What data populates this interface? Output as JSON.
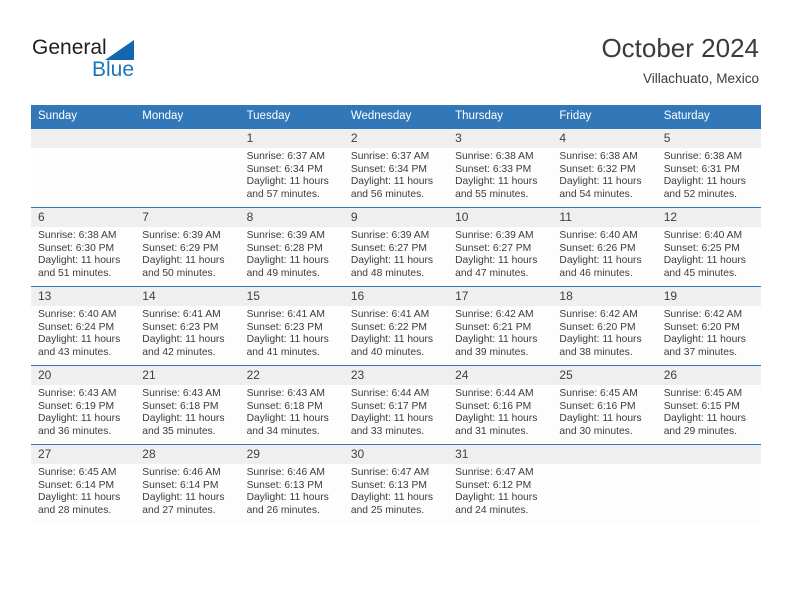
{
  "brand": {
    "name_part1": "General",
    "name_part2": "Blue",
    "triangle_icon": "triangle-icon",
    "accent_color": "#1b75bb"
  },
  "header": {
    "title": "October 2024",
    "subtitle": "Villachuato, Mexico"
  },
  "theme": {
    "header_row_bg": "#3277b8",
    "date_band_bg": "#efefef",
    "cell_bg": "#fdfdfd",
    "border_color": "#3277b8",
    "text_color": "#3c3c3c"
  },
  "labels": {
    "sunrise_prefix": "Sunrise:",
    "sunset_prefix": "Sunset:",
    "daylight_prefix": "Daylight:"
  },
  "day_headers": [
    "Sunday",
    "Monday",
    "Tuesday",
    "Wednesday",
    "Thursday",
    "Friday",
    "Saturday"
  ],
  "weeks": [
    [
      {
        "date": "",
        "empty": true
      },
      {
        "date": "",
        "empty": true
      },
      {
        "date": "1",
        "sunrise": "Sunrise: 6:37 AM",
        "sunset": "Sunset: 6:34 PM",
        "daylight_l1": "Daylight: 11 hours",
        "daylight_l2": "and 57 minutes."
      },
      {
        "date": "2",
        "sunrise": "Sunrise: 6:37 AM",
        "sunset": "Sunset: 6:34 PM",
        "daylight_l1": "Daylight: 11 hours",
        "daylight_l2": "and 56 minutes."
      },
      {
        "date": "3",
        "sunrise": "Sunrise: 6:38 AM",
        "sunset": "Sunset: 6:33 PM",
        "daylight_l1": "Daylight: 11 hours",
        "daylight_l2": "and 55 minutes."
      },
      {
        "date": "4",
        "sunrise": "Sunrise: 6:38 AM",
        "sunset": "Sunset: 6:32 PM",
        "daylight_l1": "Daylight: 11 hours",
        "daylight_l2": "and 54 minutes."
      },
      {
        "date": "5",
        "sunrise": "Sunrise: 6:38 AM",
        "sunset": "Sunset: 6:31 PM",
        "daylight_l1": "Daylight: 11 hours",
        "daylight_l2": "and 52 minutes."
      }
    ],
    [
      {
        "date": "6",
        "sunrise": "Sunrise: 6:38 AM",
        "sunset": "Sunset: 6:30 PM",
        "daylight_l1": "Daylight: 11 hours",
        "daylight_l2": "and 51 minutes."
      },
      {
        "date": "7",
        "sunrise": "Sunrise: 6:39 AM",
        "sunset": "Sunset: 6:29 PM",
        "daylight_l1": "Daylight: 11 hours",
        "daylight_l2": "and 50 minutes."
      },
      {
        "date": "8",
        "sunrise": "Sunrise: 6:39 AM",
        "sunset": "Sunset: 6:28 PM",
        "daylight_l1": "Daylight: 11 hours",
        "daylight_l2": "and 49 minutes."
      },
      {
        "date": "9",
        "sunrise": "Sunrise: 6:39 AM",
        "sunset": "Sunset: 6:27 PM",
        "daylight_l1": "Daylight: 11 hours",
        "daylight_l2": "and 48 minutes."
      },
      {
        "date": "10",
        "sunrise": "Sunrise: 6:39 AM",
        "sunset": "Sunset: 6:27 PM",
        "daylight_l1": "Daylight: 11 hours",
        "daylight_l2": "and 47 minutes."
      },
      {
        "date": "11",
        "sunrise": "Sunrise: 6:40 AM",
        "sunset": "Sunset: 6:26 PM",
        "daylight_l1": "Daylight: 11 hours",
        "daylight_l2": "and 46 minutes."
      },
      {
        "date": "12",
        "sunrise": "Sunrise: 6:40 AM",
        "sunset": "Sunset: 6:25 PM",
        "daylight_l1": "Daylight: 11 hours",
        "daylight_l2": "and 45 minutes."
      }
    ],
    [
      {
        "date": "13",
        "sunrise": "Sunrise: 6:40 AM",
        "sunset": "Sunset: 6:24 PM",
        "daylight_l1": "Daylight: 11 hours",
        "daylight_l2": "and 43 minutes."
      },
      {
        "date": "14",
        "sunrise": "Sunrise: 6:41 AM",
        "sunset": "Sunset: 6:23 PM",
        "daylight_l1": "Daylight: 11 hours",
        "daylight_l2": "and 42 minutes."
      },
      {
        "date": "15",
        "sunrise": "Sunrise: 6:41 AM",
        "sunset": "Sunset: 6:23 PM",
        "daylight_l1": "Daylight: 11 hours",
        "daylight_l2": "and 41 minutes."
      },
      {
        "date": "16",
        "sunrise": "Sunrise: 6:41 AM",
        "sunset": "Sunset: 6:22 PM",
        "daylight_l1": "Daylight: 11 hours",
        "daylight_l2": "and 40 minutes."
      },
      {
        "date": "17",
        "sunrise": "Sunrise: 6:42 AM",
        "sunset": "Sunset: 6:21 PM",
        "daylight_l1": "Daylight: 11 hours",
        "daylight_l2": "and 39 minutes."
      },
      {
        "date": "18",
        "sunrise": "Sunrise: 6:42 AM",
        "sunset": "Sunset: 6:20 PM",
        "daylight_l1": "Daylight: 11 hours",
        "daylight_l2": "and 38 minutes."
      },
      {
        "date": "19",
        "sunrise": "Sunrise: 6:42 AM",
        "sunset": "Sunset: 6:20 PM",
        "daylight_l1": "Daylight: 11 hours",
        "daylight_l2": "and 37 minutes."
      }
    ],
    [
      {
        "date": "20",
        "sunrise": "Sunrise: 6:43 AM",
        "sunset": "Sunset: 6:19 PM",
        "daylight_l1": "Daylight: 11 hours",
        "daylight_l2": "and 36 minutes."
      },
      {
        "date": "21",
        "sunrise": "Sunrise: 6:43 AM",
        "sunset": "Sunset: 6:18 PM",
        "daylight_l1": "Daylight: 11 hours",
        "daylight_l2": "and 35 minutes."
      },
      {
        "date": "22",
        "sunrise": "Sunrise: 6:43 AM",
        "sunset": "Sunset: 6:18 PM",
        "daylight_l1": "Daylight: 11 hours",
        "daylight_l2": "and 34 minutes."
      },
      {
        "date": "23",
        "sunrise": "Sunrise: 6:44 AM",
        "sunset": "Sunset: 6:17 PM",
        "daylight_l1": "Daylight: 11 hours",
        "daylight_l2": "and 33 minutes."
      },
      {
        "date": "24",
        "sunrise": "Sunrise: 6:44 AM",
        "sunset": "Sunset: 6:16 PM",
        "daylight_l1": "Daylight: 11 hours",
        "daylight_l2": "and 31 minutes."
      },
      {
        "date": "25",
        "sunrise": "Sunrise: 6:45 AM",
        "sunset": "Sunset: 6:16 PM",
        "daylight_l1": "Daylight: 11 hours",
        "daylight_l2": "and 30 minutes."
      },
      {
        "date": "26",
        "sunrise": "Sunrise: 6:45 AM",
        "sunset": "Sunset: 6:15 PM",
        "daylight_l1": "Daylight: 11 hours",
        "daylight_l2": "and 29 minutes."
      }
    ],
    [
      {
        "date": "27",
        "sunrise": "Sunrise: 6:45 AM",
        "sunset": "Sunset: 6:14 PM",
        "daylight_l1": "Daylight: 11 hours",
        "daylight_l2": "and 28 minutes."
      },
      {
        "date": "28",
        "sunrise": "Sunrise: 6:46 AM",
        "sunset": "Sunset: 6:14 PM",
        "daylight_l1": "Daylight: 11 hours",
        "daylight_l2": "and 27 minutes."
      },
      {
        "date": "29",
        "sunrise": "Sunrise: 6:46 AM",
        "sunset": "Sunset: 6:13 PM",
        "daylight_l1": "Daylight: 11 hours",
        "daylight_l2": "and 26 minutes."
      },
      {
        "date": "30",
        "sunrise": "Sunrise: 6:47 AM",
        "sunset": "Sunset: 6:13 PM",
        "daylight_l1": "Daylight: 11 hours",
        "daylight_l2": "and 25 minutes."
      },
      {
        "date": "31",
        "sunrise": "Sunrise: 6:47 AM",
        "sunset": "Sunset: 6:12 PM",
        "daylight_l1": "Daylight: 11 hours",
        "daylight_l2": "and 24 minutes."
      },
      {
        "date": "",
        "empty": true
      },
      {
        "date": "",
        "empty": true
      }
    ]
  ]
}
